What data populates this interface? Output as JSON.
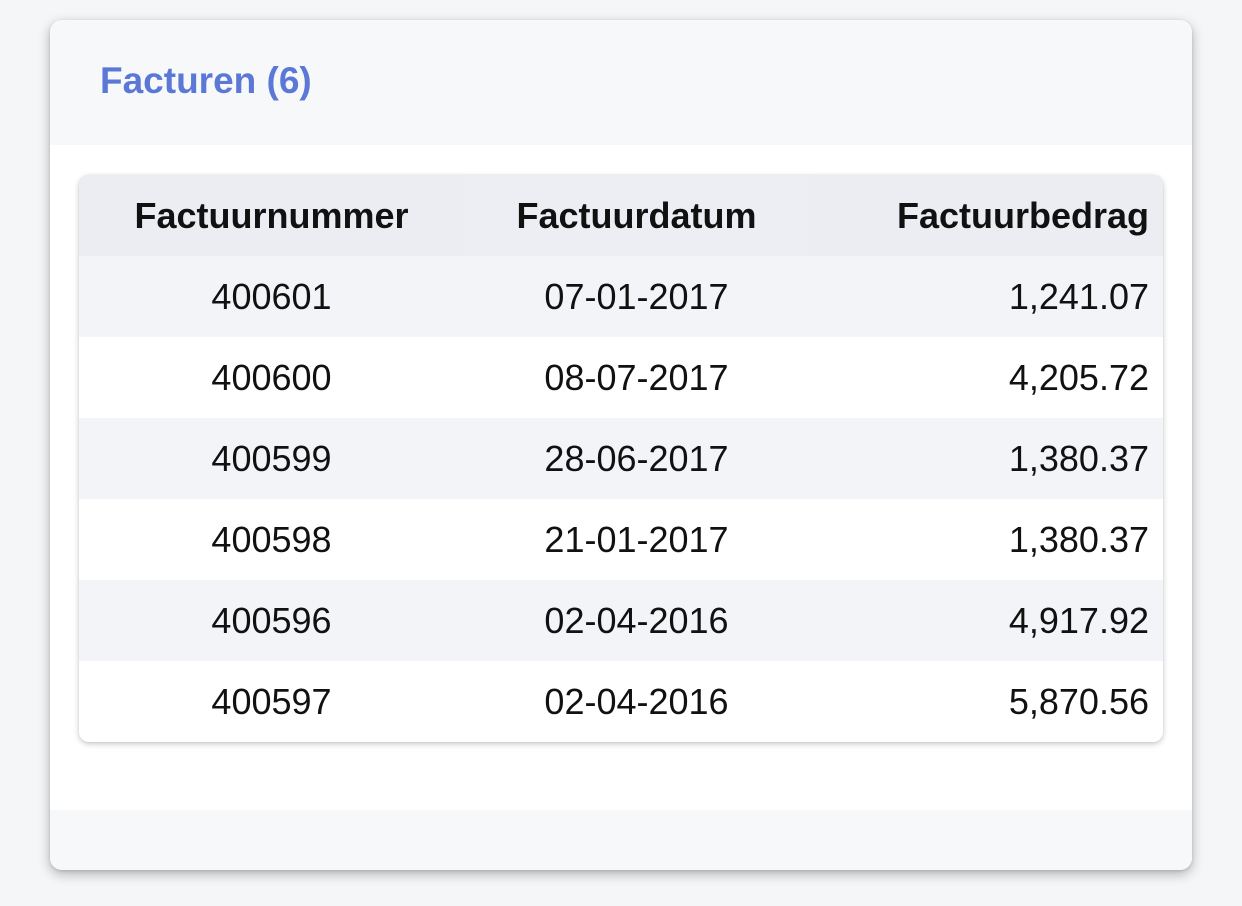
{
  "card": {
    "title": "Facturen (6)"
  },
  "table": {
    "headers": {
      "number": "Factuurnummer",
      "date": "Factuurdatum",
      "amount": "Factuurbedrag"
    },
    "rows": [
      {
        "number": "400601",
        "date": "07-01-2017",
        "amount": "1,241.07"
      },
      {
        "number": "400600",
        "date": "08-07-2017",
        "amount": "4,205.72"
      },
      {
        "number": "400599",
        "date": "28-06-2017",
        "amount": "1,380.37"
      },
      {
        "number": "400598",
        "date": "21-01-2017",
        "amount": "1,380.37"
      },
      {
        "number": "400596",
        "date": "02-04-2016",
        "amount": "4,917.92"
      },
      {
        "number": "400597",
        "date": "02-04-2016",
        "amount": "5,870.56"
      }
    ]
  },
  "colors": {
    "title": "#5b78d6",
    "header_bg": "#ebedf3",
    "stripe_bg": "#f3f4f8"
  }
}
